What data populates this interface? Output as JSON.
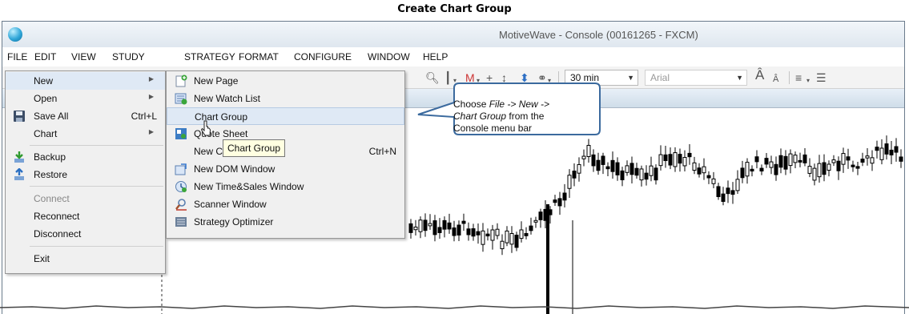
{
  "doc_title": "Create Chart Group",
  "window": {
    "title": "MotiveWave - Console (00161265 - FXCM)"
  },
  "menubar": {
    "items": [
      "FILE",
      "EDIT",
      "VIEW",
      "STUDY",
      "STRATEGY",
      "FORMAT",
      "CONFIGURE",
      "WINDOW",
      "HELP"
    ]
  },
  "toolbar": {
    "timeframe": "30 min",
    "font": "Arial",
    "font_grow_icon": "font-increase-icon",
    "font_shrink_icon": "font-decrease-icon"
  },
  "file_menu": {
    "items": [
      {
        "label": "New",
        "has_submenu": true,
        "highlighted": true
      },
      {
        "label": "Open",
        "has_submenu": true
      },
      {
        "label": "Save All",
        "accel": "Ctrl+L",
        "icon": "save-icon"
      },
      {
        "label": "Chart",
        "has_submenu": true
      },
      {
        "label": "Backup",
        "icon": "backup-icon"
      },
      {
        "label": "Restore",
        "icon": "restore-icon"
      },
      {
        "label": "Connect",
        "disabled": true
      },
      {
        "label": "Reconnect"
      },
      {
        "label": "Disconnect"
      },
      {
        "label": "Exit"
      }
    ]
  },
  "new_menu": {
    "items": [
      {
        "label": "New Page",
        "icon": "new-page-icon"
      },
      {
        "label": "New Watch List",
        "icon": "watch-list-icon"
      },
      {
        "label": "Chart Group",
        "highlighted": true
      },
      {
        "label": "Quote Sheet",
        "icon": "quote-sheet-icon"
      },
      {
        "label": "New Cha",
        "accel": "Ctrl+N"
      },
      {
        "label": "New DOM Window",
        "icon": "dom-window-icon"
      },
      {
        "label": "New Time&Sales Window",
        "icon": "time-sales-icon"
      },
      {
        "label": "Scanner Window",
        "icon": "scanner-icon"
      },
      {
        "label": "Strategy Optimizer",
        "icon": "optimizer-icon"
      }
    ]
  },
  "tooltip": "Chart Group",
  "callout": {
    "line1_pre": "Choose ",
    "line1_italic": "File -> New ->",
    "line2_italic": "Chart Group",
    "line2_post": " from the",
    "line3": "Console menu bar"
  },
  "colors": {
    "menu_highlight": "#dfe9f5",
    "callout_border": "#3b6a9e",
    "tabstrip": "#cfdde9"
  }
}
